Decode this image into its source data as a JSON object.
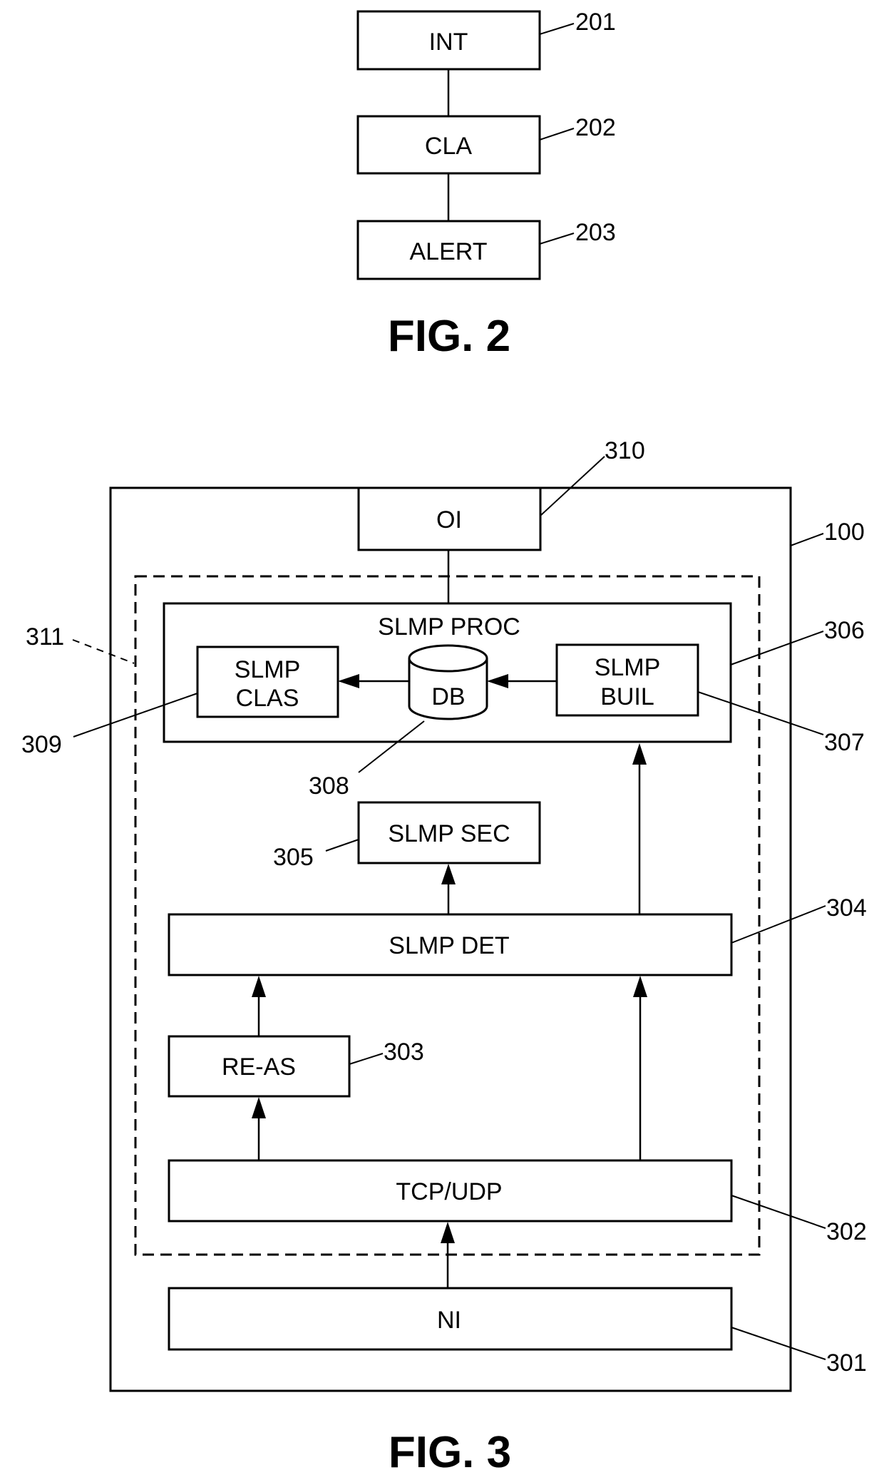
{
  "figure2": {
    "caption": "FIG. 2",
    "blocks": [
      {
        "id": "int",
        "label": "INT",
        "ref": "201"
      },
      {
        "id": "cla",
        "label": "CLA",
        "ref": "202"
      },
      {
        "id": "alert",
        "label": "ALERT",
        "ref": "203"
      }
    ]
  },
  "figure3": {
    "caption": "FIG. 3",
    "device_ref": "100",
    "dashed_group_ref": "311",
    "blocks": {
      "oi": {
        "label": "OI",
        "ref": "310"
      },
      "proc": {
        "label": "SLMP PROC",
        "ref": "306"
      },
      "clas": {
        "line1": "SLMP",
        "line2": "CLAS",
        "ref": "309"
      },
      "db": {
        "label": "DB",
        "ref": "308"
      },
      "buil": {
        "line1": "SLMP",
        "line2": "BUIL",
        "ref": "307"
      },
      "sec": {
        "label": "SLMP SEC",
        "ref": "305"
      },
      "det": {
        "label": "SLMP DET",
        "ref": "304"
      },
      "reas": {
        "label": "RE-AS",
        "ref": "303"
      },
      "tcp": {
        "label": "TCP/UDP",
        "ref": "302"
      },
      "ni": {
        "label": "NI",
        "ref": "301"
      }
    }
  }
}
